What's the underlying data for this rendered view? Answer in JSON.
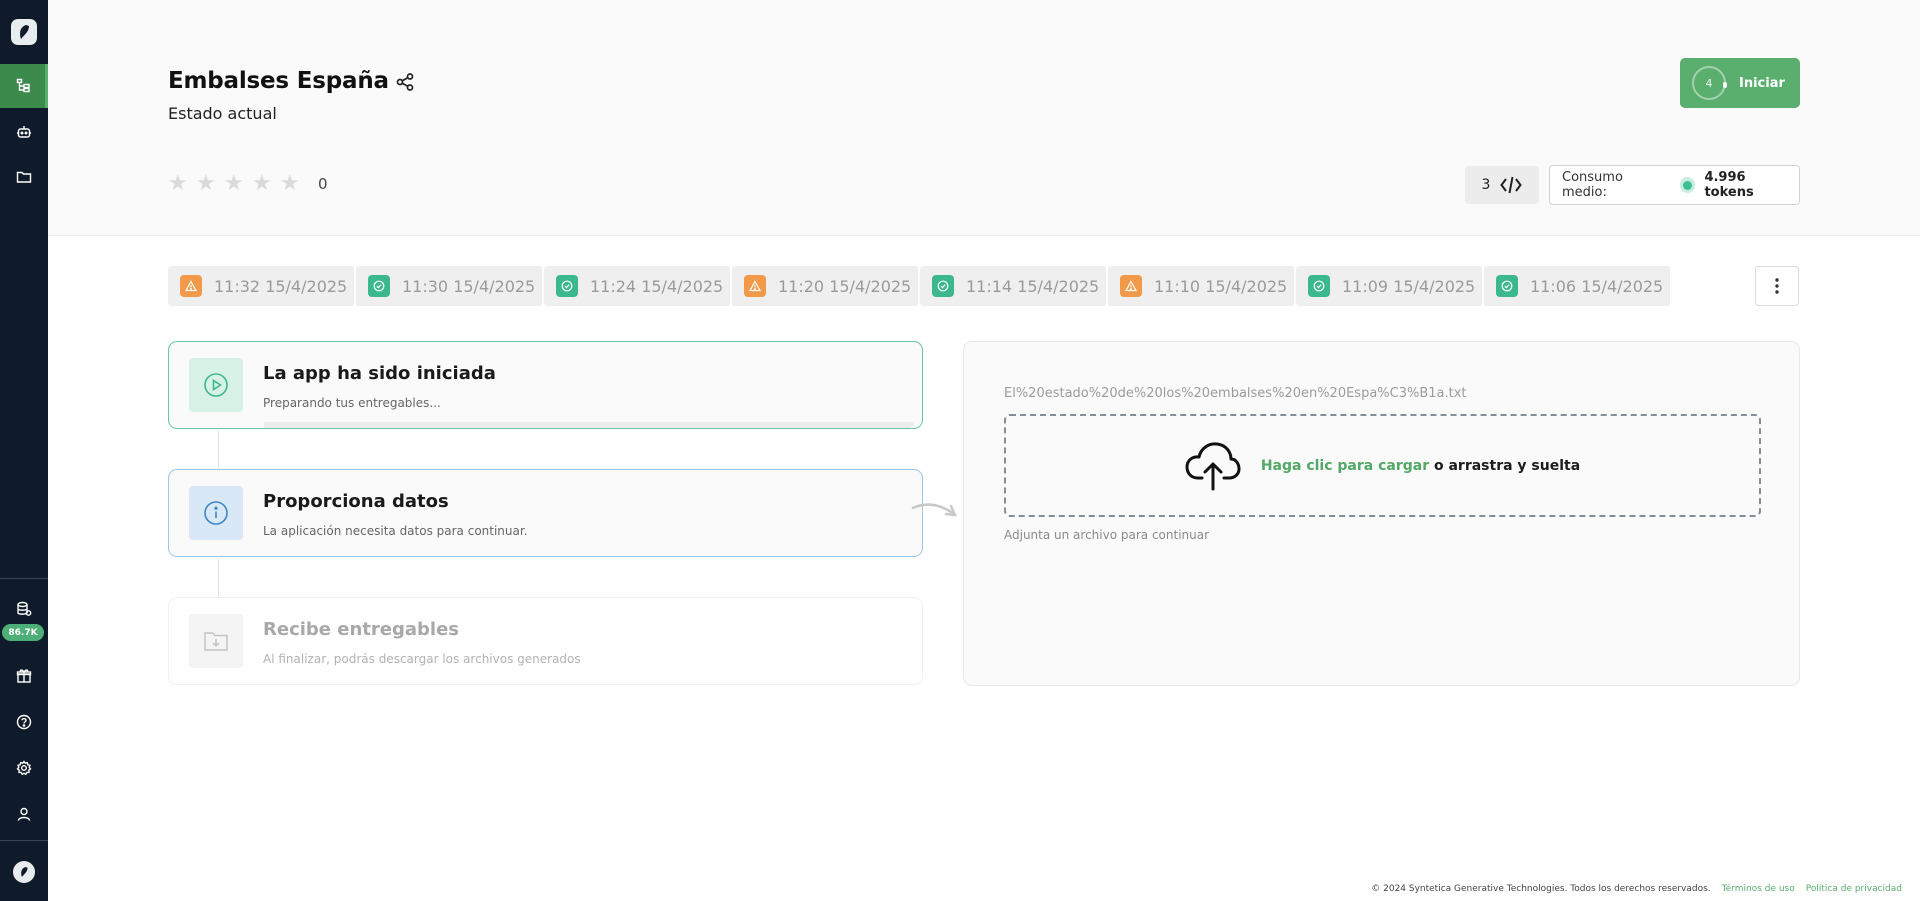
{
  "sidebar": {
    "badge": "86.7K"
  },
  "header": {
    "title": "Embalses España",
    "subtitle": "Estado actual",
    "start_ring_value": "4",
    "start_label": "Iniciar",
    "rating_count": "0",
    "rating_stars": 0,
    "code_count": "3",
    "consumo_label": "Consumo medio:",
    "consumo_value": "4.996 tokens"
  },
  "runs": [
    {
      "status": "warning",
      "label": "11:32 15/4/2025"
    },
    {
      "status": "success",
      "label": "11:30 15/4/2025"
    },
    {
      "status": "success",
      "label": "11:24 15/4/2025"
    },
    {
      "status": "warning",
      "label": "11:20 15/4/2025"
    },
    {
      "status": "success",
      "label": "11:14 15/4/2025"
    },
    {
      "status": "warning",
      "label": "11:10 15/4/2025"
    },
    {
      "status": "success",
      "label": "11:09 15/4/2025"
    },
    {
      "status": "success",
      "label": "11:06 15/4/2025"
    }
  ],
  "steps": [
    {
      "title": "La app ha sido iniciada",
      "desc": "Preparando tus entregables..."
    },
    {
      "title": "Proporciona datos",
      "desc": "La aplicación necesita datos para continuar."
    },
    {
      "title": "Recibe entregables",
      "desc": "Al finalizar, podrás descargar los archivos generados"
    }
  ],
  "upload": {
    "file_name": "El%20estado%20de%20los%20embalses%20en%20Espa%C3%B1a.txt",
    "link_text": "Haga clic para cargar",
    "rest_text": " o arrastra y suelta",
    "hint": "Adjunta un archivo para continuar"
  },
  "footer": {
    "copyright": "© 2024 Syntetica Generative Technologies. Todos los derechos reservados.",
    "terms": "Términos de uso",
    "privacy": "Política de privacidad"
  },
  "colors": {
    "accent": "#5aae6e",
    "sidebar": "#0f1a2b",
    "success": "#3bb88e",
    "warning": "#f29a4a"
  }
}
